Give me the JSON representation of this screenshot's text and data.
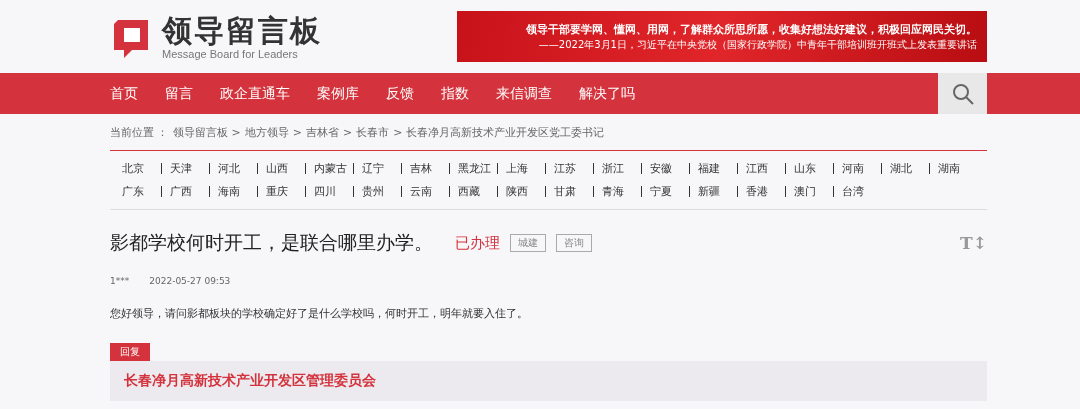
{
  "logo": {
    "title": "领导留言板",
    "subtitle": "Message Board for Leaders"
  },
  "banner": {
    "headline": "领导干部要学网、懂网、用网，了解群众所思所愿，收集好想法好建议，积极回应网民关切。",
    "source": "——2022年3月1日，习近平在中央党校（国家行政学院）中青年干部培训班开班式上发表重要讲话"
  },
  "nav": {
    "items": [
      "首页",
      "留言",
      "政企直通车",
      "案例库",
      "反馈",
      "指数",
      "来信调查",
      "解决了吗"
    ]
  },
  "breadcrumb": {
    "label": "当前位置 ：",
    "items": [
      "领导留言板",
      "地方领导",
      "吉林省",
      "长春市",
      "长春净月高新技术产业开发区党工委书记"
    ],
    "separator": ">"
  },
  "regions": [
    [
      "北京",
      "天津",
      "河北",
      "山西",
      "内蒙古",
      "辽宁",
      "吉林",
      "黑龙江",
      "上海",
      "江苏",
      "浙江",
      "安徽",
      "福建",
      "江西",
      "山东",
      "河南",
      "湖北",
      "湖南"
    ],
    [
      "广东",
      "广西",
      "海南",
      "重庆",
      "四川",
      "贵州",
      "云南",
      "西藏",
      "陕西",
      "甘肃",
      "青海",
      "宁夏",
      "新疆",
      "香港",
      "澳门",
      "台湾"
    ]
  ],
  "message": {
    "title": "影都学校何时开工，是联合哪里办学。",
    "status": "已办理",
    "tags": [
      "城建",
      "咨询"
    ],
    "font_toggle": "T↕",
    "author": "1***",
    "time": "2022-05-27 09:53",
    "body": "您好领导，请问影都板块的学校确定好了是什么学校吗，何时开工，明年就要入住了。"
  },
  "reply": {
    "label": "回复",
    "organization": "长春净月高新技术产业开发区管理委员会"
  }
}
